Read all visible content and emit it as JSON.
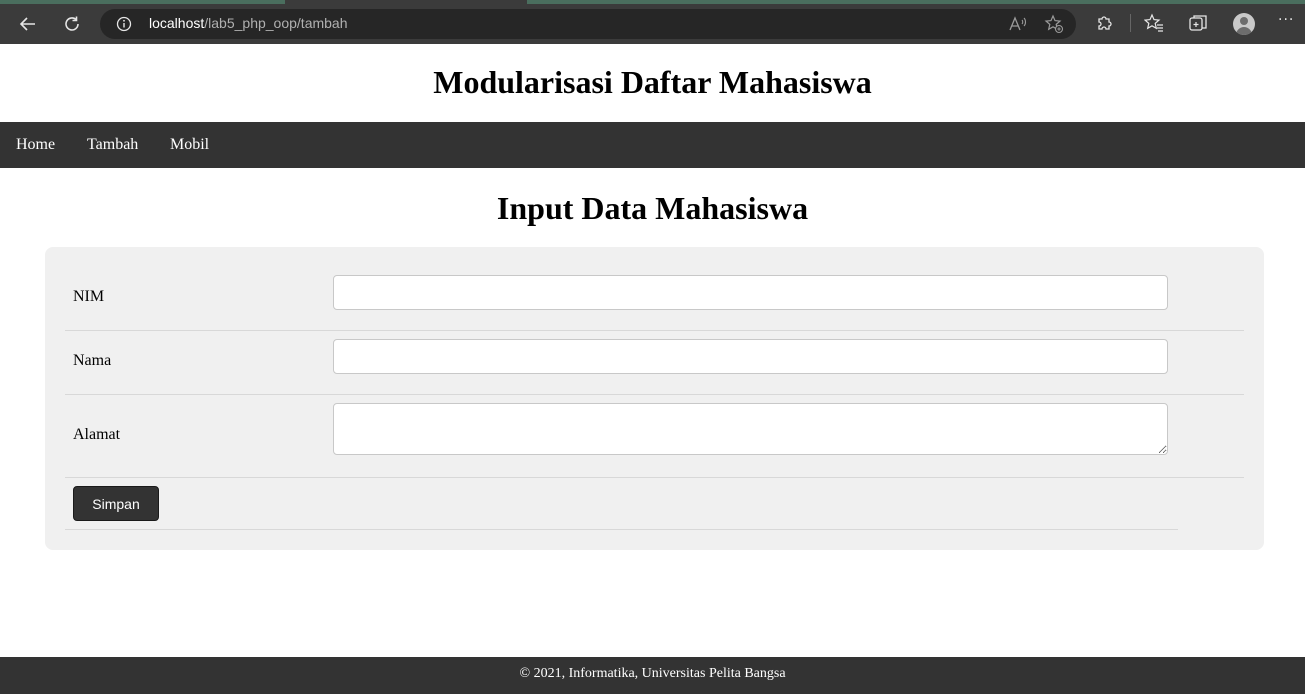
{
  "browser": {
    "url_host": "localhost",
    "url_path": "/lab5_php_oop/tambah"
  },
  "header": {
    "title": "Modularisasi Daftar Mahasiswa"
  },
  "nav": {
    "items": [
      {
        "label": "Home"
      },
      {
        "label": "Tambah"
      },
      {
        "label": "Mobil"
      }
    ]
  },
  "main": {
    "title": "Input Data Mahasiswa",
    "form": {
      "fields": [
        {
          "label": "NIM",
          "value": "",
          "placeholder": ""
        },
        {
          "label": "Nama",
          "value": "",
          "placeholder": ""
        },
        {
          "label": "Alamat",
          "value": "",
          "placeholder": ""
        }
      ],
      "submit_label": "Simpan"
    }
  },
  "footer": {
    "text": "© 2021, Informatika, Universitas Pelita Bangsa"
  },
  "colors": {
    "chrome": "#3b3b3b",
    "nav": "#333333",
    "panel": "#f0f0f0",
    "tabstrip": "#4a6e5e"
  }
}
